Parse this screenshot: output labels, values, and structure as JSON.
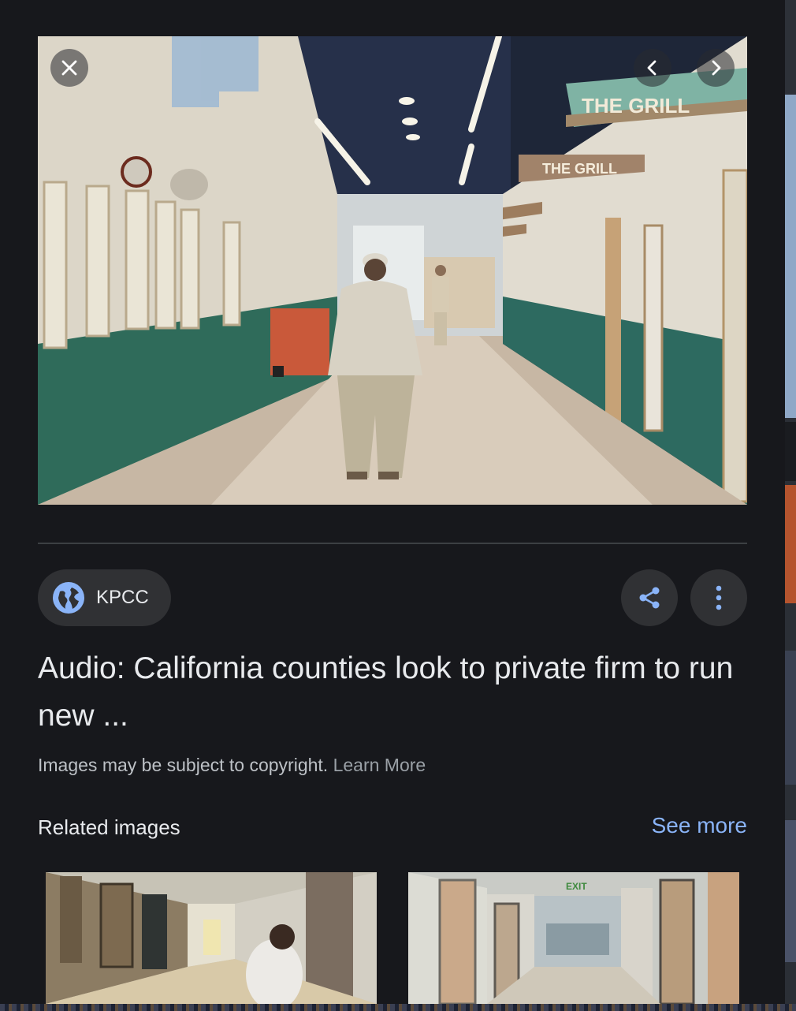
{
  "viewer": {
    "image": {
      "description_icon": "corridor-photo",
      "signs": [
        "THE GRILL",
        "THE GRILL"
      ]
    },
    "close_icon": "close-icon",
    "prev_icon": "chevron-left-icon",
    "next_icon": "chevron-right-icon"
  },
  "source": {
    "name": "KPCC",
    "icon": "globe-icon"
  },
  "actions": {
    "share_icon": "share-icon",
    "more_icon": "more-vert-icon"
  },
  "title": "Audio: California counties look to private firm to run new ...",
  "copyright": {
    "text": "Images may be subject to copyright.",
    "link": "Learn More"
  },
  "related": {
    "heading": "Related images",
    "see_more": "See more",
    "thumbnails": [
      {
        "icon": "hallway-photo"
      },
      {
        "icon": "exit-hallway-photo",
        "sign": "EXIT"
      }
    ]
  },
  "colors": {
    "background": "#17181c",
    "chip": "#303134",
    "accent_link": "#8ab4f8",
    "text_primary": "#e8eaed",
    "text_secondary": "#bdc1c6"
  }
}
